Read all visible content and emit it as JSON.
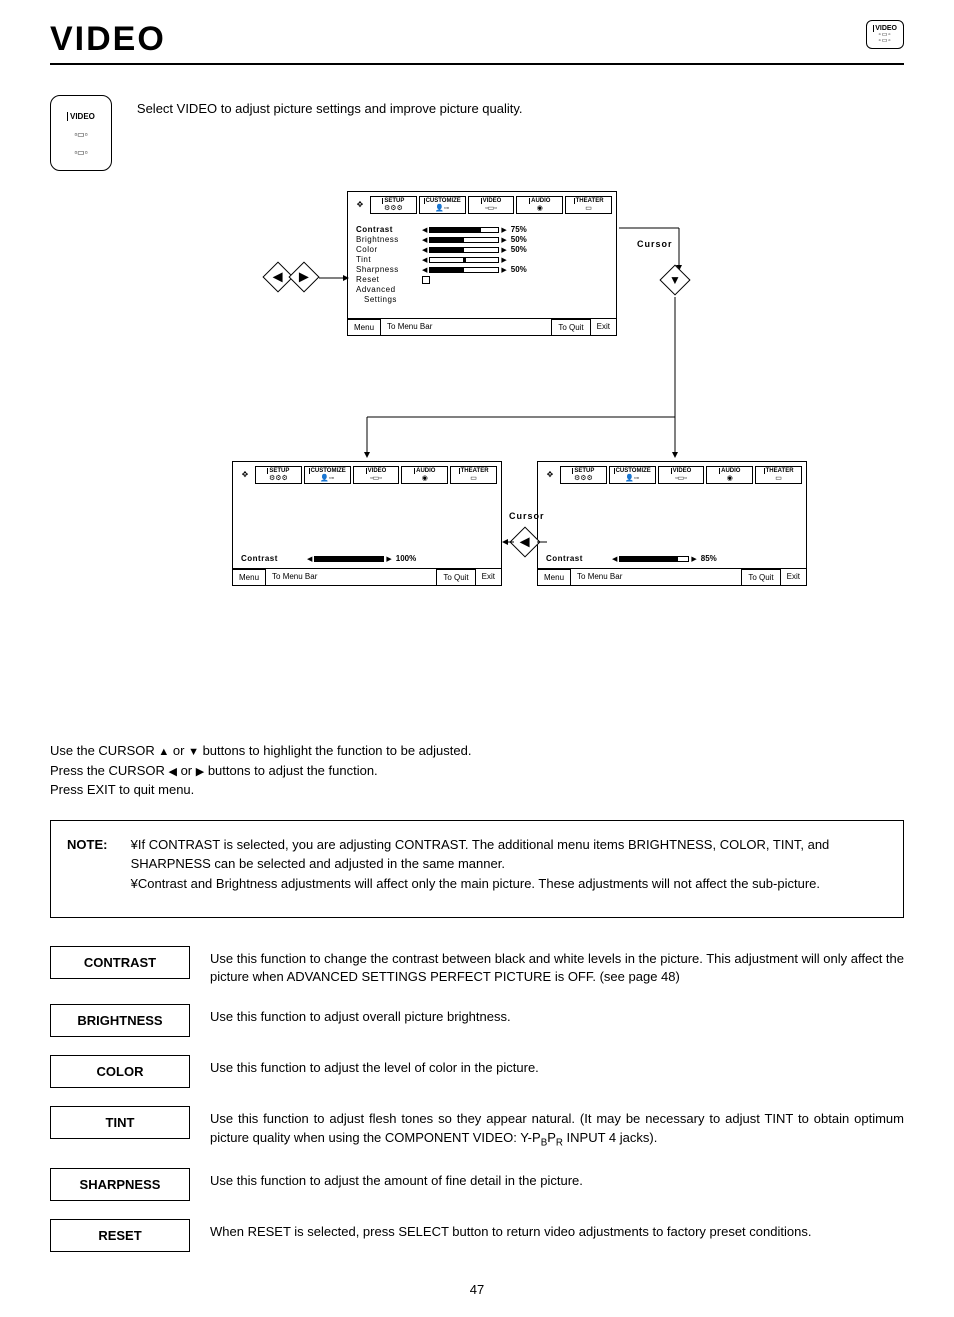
{
  "header": {
    "title": "VIDEO",
    "mini_label": "VIDEO"
  },
  "intro": {
    "icon_label": "VIDEO",
    "text": "Select VIDEO to adjust picture settings and improve picture quality."
  },
  "osd_tabs": [
    "SETUP",
    "CUSTOMIZE",
    "VIDEO",
    "AUDIO",
    "THEATER"
  ],
  "osd_main": {
    "rows": [
      {
        "label": "Contrast",
        "bold": true,
        "pct": 75,
        "val": "75%"
      },
      {
        "label": "Brightness",
        "pct": 50,
        "val": "50%"
      },
      {
        "label": "Color",
        "pct": 50,
        "val": "50%"
      },
      {
        "label": "Tint",
        "pct": 50,
        "val": "",
        "tint": true
      },
      {
        "label": "Sharpness",
        "pct": 50,
        "val": "50%"
      },
      {
        "label": "Reset",
        "check": true
      },
      {
        "label": "Advanced"
      },
      {
        "label": "  Settings",
        "indent": true
      }
    ],
    "foot": {
      "menu": "Menu",
      "menu_r": "To Menu Bar",
      "quit": "To Quit",
      "quit_r": "Exit"
    }
  },
  "cursor_label": "Cursor",
  "osd_left": {
    "contrast_label": "Contrast",
    "contrast_val": "100%",
    "contrast_pct": 100
  },
  "osd_right": {
    "contrast_label": "Contrast",
    "contrast_val": "85%",
    "contrast_pct": 85
  },
  "instructions": {
    "line1_a": "Use the CURSOR ",
    "line1_b": " or ",
    "line1_c": " buttons to highlight the function to be adjusted.",
    "line2_a": "Press the CURSOR ",
    "line2_b": " or ",
    "line2_c": " buttons to adjust the function.",
    "line3": "Press EXIT to quit menu."
  },
  "note": {
    "label": "NOTE:",
    "bullet": "¥",
    "item1": "If CONTRAST is selected, you are adjusting CONTRAST.  The additional menu items BRIGHTNESS, COLOR, TINT, and SHARPNESS can be selected and adjusted in the same manner.",
    "item2": "Contrast and Brightness adjustments will affect only the main picture. These adjustments will not affect the sub-picture."
  },
  "functions": [
    {
      "label": "CONTRAST",
      "text": "Use this function to change the contrast between black and white levels in the picture.  This adjustment will only affect the picture when ADVANCED SETTINGS PERFECT PICTURE is OFF. (see page 48)"
    },
    {
      "label": "BRIGHTNESS",
      "text": "Use this function to adjust overall picture brightness."
    },
    {
      "label": "COLOR",
      "text": "Use this function to adjust the level of color in the picture."
    },
    {
      "label": "TINT",
      "text": "Use this function to adjust flesh tones so they appear natural. (It may be necessary to adjust TINT to obtain optimum picture quality when using the COMPONENT VIDEO: Y-P_BP_R INPUT 4 jacks)."
    },
    {
      "label": "SHARPNESS",
      "text": "Use this function to adjust the amount of fine detail in the picture."
    },
    {
      "label": "RESET",
      "text": "When RESET is selected, press SELECT button to return video adjustments to factory preset conditions."
    }
  ],
  "page_number": "47"
}
